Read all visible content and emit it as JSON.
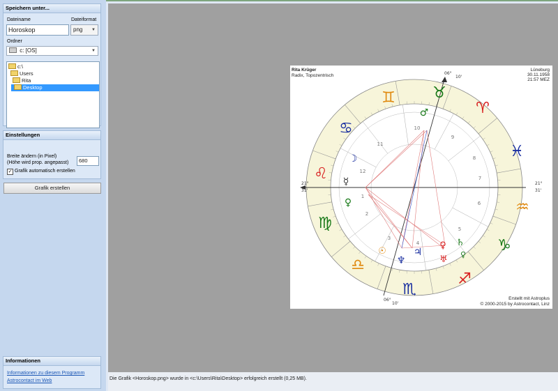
{
  "save": {
    "title": "Speichern unter...",
    "filename_label": "Dateiname",
    "filename_value": "Horoskop",
    "format_label": "Dateiformat",
    "format_value": "png",
    "folder_label": "Ordner",
    "drive_value": "c: [OS]",
    "tree": [
      "c:\\",
      "Users",
      "Rita",
      "Desktop"
    ]
  },
  "settings": {
    "title": "Einstellungen",
    "width_label_line1": "Breite ändern (in Pixel)",
    "width_label_line2": "(Höhe wird prop. angepasst)",
    "width_value": "680",
    "auto_create_label": "Grafik automatisch erstellen",
    "auto_create_checked": true
  },
  "create_button": "Grafik erstellen",
  "info": {
    "title": "Informationen",
    "link1": "Informationen zu diesem Programm",
    "link2": "Astrocontact im Web"
  },
  "chart": {
    "name": "Rita Krüger",
    "subtitle": "Radix, Topozentrisch",
    "place": "Lüneburg",
    "date": "30.11.1958",
    "time": "21:57 MEZ",
    "credit1": "Erstellt mit Astroplus",
    "credit2": "© 2000-2015 by Astrocontact, Linz",
    "deg_top": "06°",
    "min_top": "10'",
    "deg_bottom": "06°",
    "min_bottom": "10'",
    "deg_left": "21°",
    "min_left": "31'",
    "deg_right": "21°",
    "min_right": "31'",
    "house_numbers": [
      "1",
      "2",
      "3",
      "4",
      "5",
      "6",
      "7",
      "8",
      "9",
      "10",
      "11",
      "12"
    ]
  },
  "status": "Die Grafik <Horoskop.png> wurde in <c:\\Users\\Rita\\Desktop> erfolgreich erstellt (0,25 MB).",
  "colors": {
    "sidebar_bg": "#c5d7ee",
    "selection": "#3399ff",
    "workspace": "#a0a0a0",
    "zodiac_band": "#f7f5da"
  }
}
